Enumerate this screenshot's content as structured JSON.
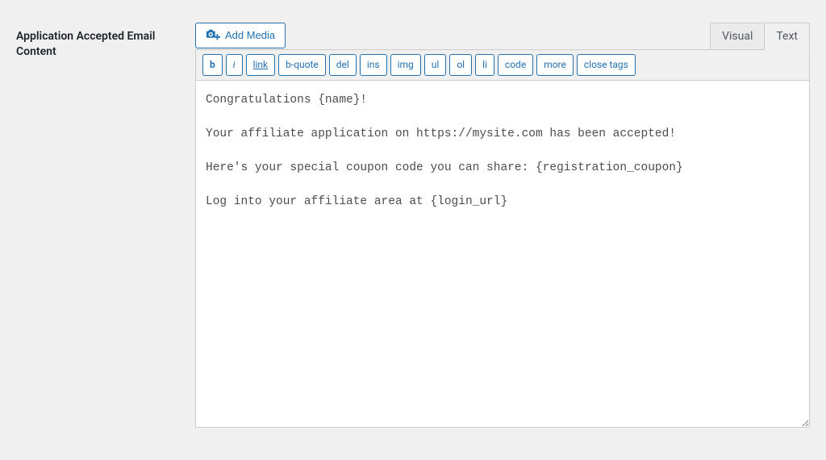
{
  "label": "Application Accepted Email Content",
  "toolbar": {
    "add_media": "Add Media",
    "tabs": {
      "visual": "Visual",
      "text": "Text",
      "active": "text"
    },
    "quicktags": [
      {
        "id": "b",
        "label": "b",
        "style": "bold"
      },
      {
        "id": "i",
        "label": "i",
        "style": "italic"
      },
      {
        "id": "link",
        "label": "link",
        "style": "underline"
      },
      {
        "id": "b-quote",
        "label": "b-quote",
        "style": ""
      },
      {
        "id": "del",
        "label": "del",
        "style": ""
      },
      {
        "id": "ins",
        "label": "ins",
        "style": ""
      },
      {
        "id": "img",
        "label": "img",
        "style": ""
      },
      {
        "id": "ul",
        "label": "ul",
        "style": ""
      },
      {
        "id": "ol",
        "label": "ol",
        "style": ""
      },
      {
        "id": "li",
        "label": "li",
        "style": ""
      },
      {
        "id": "code",
        "label": "code",
        "style": ""
      },
      {
        "id": "more",
        "label": "more",
        "style": ""
      },
      {
        "id": "close-tags",
        "label": "close tags",
        "style": ""
      }
    ]
  },
  "content": "Congratulations {name}!\n\nYour affiliate application on https://mysite.com has been accepted!\n\nHere's your special coupon code you can share: {registration_coupon}\n\nLog into your affiliate area at {login_url}"
}
